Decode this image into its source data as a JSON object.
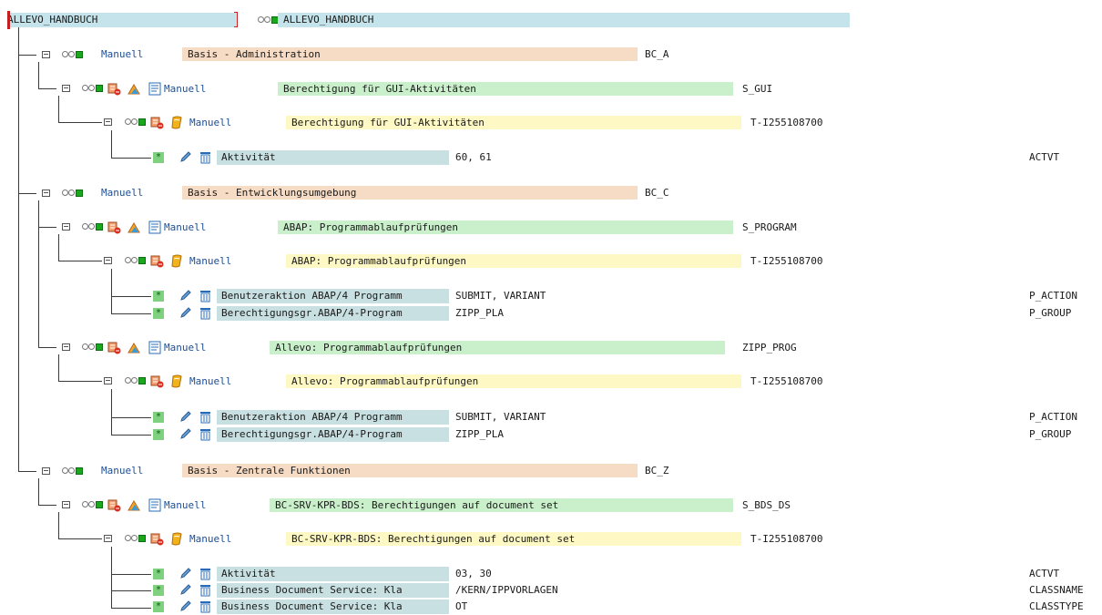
{
  "root": {
    "label": "ALLEVO_HANDBUCH",
    "title": "ALLEVO_HANDBUCH"
  },
  "rows": {
    "r1": {
      "status": "Manuell",
      "text": "Basis - Administration",
      "tech": "BC_A"
    },
    "r2": {
      "status": "Manuell",
      "text": "Berechtigung für GUI-Aktivitäten",
      "tech": "S_GUI"
    },
    "r3": {
      "status": "Manuell",
      "text": "Berechtigung für GUI-Aktivitäten",
      "tech": "T-I255108700"
    },
    "r4": {
      "field": "Aktivität",
      "value": "60, 61",
      "tech": "ACTVT"
    },
    "r5": {
      "status": "Manuell",
      "text": "Basis - Entwicklungsumgebung",
      "tech": "BC_C"
    },
    "r6": {
      "status": "Manuell",
      "text": "ABAP: Programmablaufprüfungen",
      "tech": "S_PROGRAM"
    },
    "r7": {
      "status": "Manuell",
      "text": "ABAP: Programmablaufprüfungen",
      "tech": "T-I255108700"
    },
    "r8": {
      "field": "Benutzeraktion ABAP/4 Programm",
      "value": "SUBMIT, VARIANT",
      "tech": "P_ACTION"
    },
    "r9": {
      "field": "Berechtigungsgr.ABAP/4-Program",
      "value": "ZIPP_PLA",
      "tech": "P_GROUP"
    },
    "r10": {
      "status": "Manuell",
      "text": "Allevo: Programmablaufprüfungen",
      "tech": "ZIPP_PROG"
    },
    "r11": {
      "status": "Manuell",
      "text": "Allevo: Programmablaufprüfungen",
      "tech": "T-I255108700"
    },
    "r12": {
      "field": "Benutzeraktion ABAP/4 Programm",
      "value": "SUBMIT, VARIANT",
      "tech": "P_ACTION"
    },
    "r13": {
      "field": "Berechtigungsgr.ABAP/4-Program",
      "value": "ZIPP_PLA",
      "tech": "P_GROUP"
    },
    "r14": {
      "status": "Manuell",
      "text": "Basis - Zentrale Funktionen",
      "tech": "BC_Z"
    },
    "r15": {
      "status": "Manuell",
      "text": "BC-SRV-KPR-BDS: Berechtigungen auf document set",
      "tech": "S_BDS_DS"
    },
    "r16": {
      "status": "Manuell",
      "text": "BC-SRV-KPR-BDS: Berechtigungen auf document set",
      "tech": "T-I255108700"
    },
    "r17": {
      "field": "Aktivität",
      "value": "03, 30",
      "tech": "ACTVT"
    },
    "r18": {
      "field": "Business Document Service: Kla",
      "value": "/KERN/IPPVORLAGEN",
      "tech": "CLASSNAME"
    },
    "r19": {
      "field": "Business Document Service: Kla",
      "value": "OT",
      "tech": "CLASSTYPE"
    }
  },
  "icons": {
    "expand": "collapse-folder-icon",
    "traffic": "traffic-light-status-icon",
    "profile": "profile-icon",
    "org": "org-level-icon",
    "list": "field-list-icon",
    "auth": "authorization-icon",
    "star": "maintained-star-icon",
    "edit": "pencil-edit-icon",
    "delete": "trash-delete-icon"
  },
  "colors": {
    "header": "#c4e3ea",
    "category": "#f6dcc4",
    "object": "#caf0cb",
    "authorization": "#fdf8c4",
    "field": "#c8e0e1",
    "link": "#1d4f96"
  }
}
